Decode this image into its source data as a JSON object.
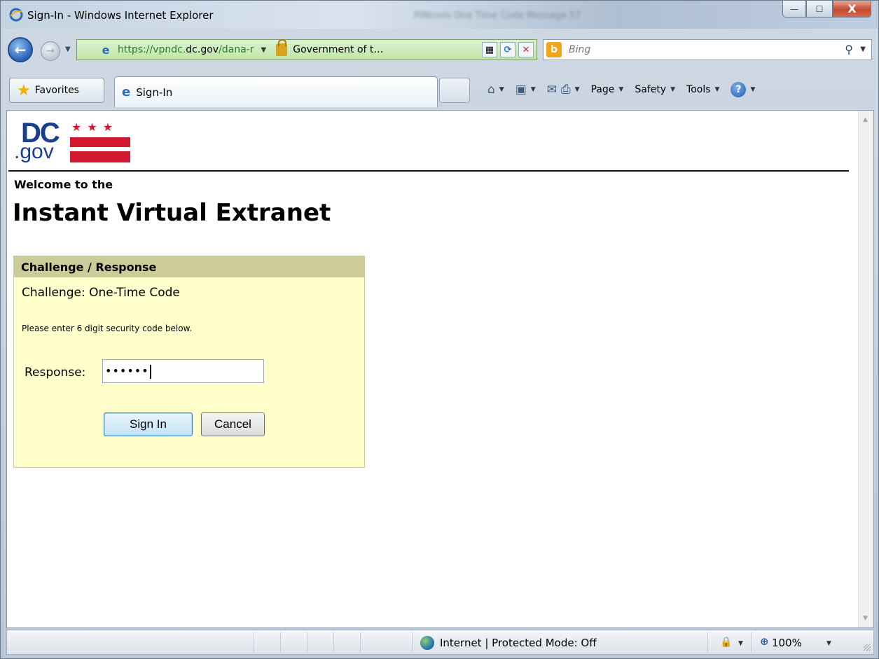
{
  "window": {
    "title": "Sign-In - Windows Internet Explorer",
    "background_title": "PINtools One Time Code Message 57",
    "controls": {
      "minimize": "—",
      "maximize": "☐",
      "close": "X"
    }
  },
  "address_bar": {
    "url_scheme": "https://",
    "url_host_prefix": "vpndc.",
    "url_host_main": "dc.gov",
    "url_path": "/dana-r",
    "certificate_label": "Government of t…",
    "security_color": "#bfe6a8"
  },
  "search": {
    "placeholder": "Bing",
    "provider_icon": "bing-icon"
  },
  "toolbar": {
    "favorites_label": "Favorites",
    "tab_label": "Sign-In",
    "commands": {
      "page": "Page",
      "safety": "Safety",
      "tools": "Tools"
    }
  },
  "page": {
    "logo": {
      "dc": "DC",
      "gov": ".gov",
      "stars": "★★★"
    },
    "welcome": "Welcome to the",
    "heading": "Instant Virtual Extranet",
    "panel": {
      "header": "Challenge / Response",
      "challenge": "Challenge: One-Time Code",
      "instruction": "Please enter 6 digit security code below.",
      "response_label": "Response:",
      "response_value": "••••••",
      "sign_in_label": "Sign In",
      "cancel_label": "Cancel"
    },
    "colors": {
      "panel_bg": "#ffffcc",
      "panel_header": "#cccc99",
      "brand_blue": "#1b3f8f",
      "brand_red": "#d0182f"
    }
  },
  "statusbar": {
    "zone": "Internet | Protected Mode: Off",
    "zoom": "100%"
  }
}
